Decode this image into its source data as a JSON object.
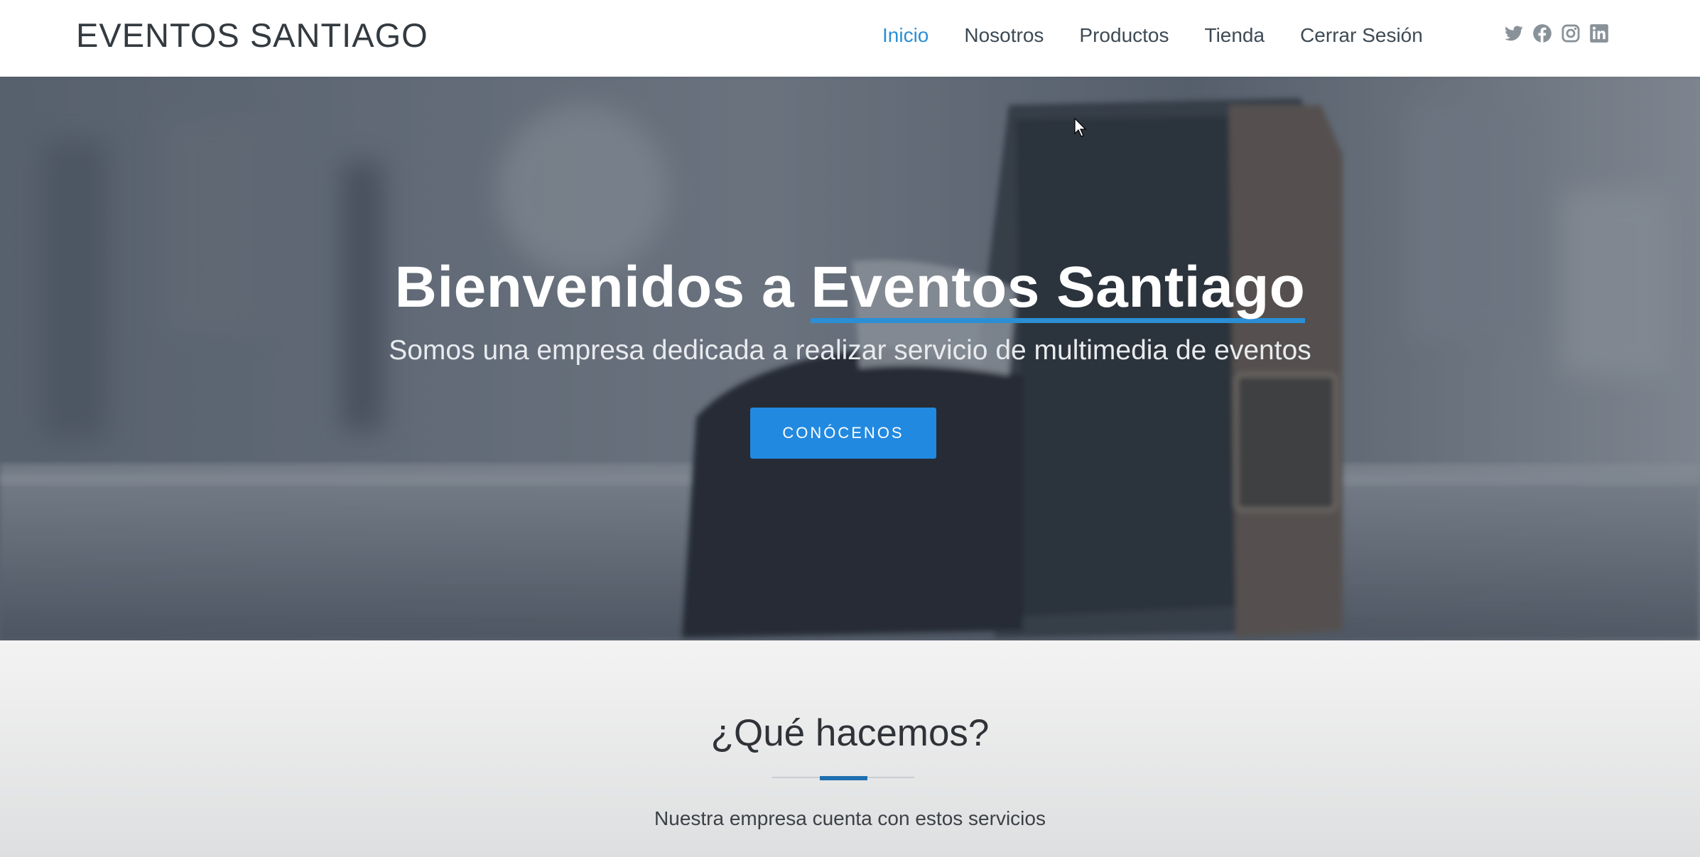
{
  "header": {
    "brand": "EVENTOS SANTIAGO",
    "nav": [
      {
        "label": "Inicio",
        "active": true
      },
      {
        "label": "Nosotros",
        "active": false
      },
      {
        "label": "Productos",
        "active": false
      },
      {
        "label": "Tienda",
        "active": false
      },
      {
        "label": "Cerrar Sesión",
        "active": false
      }
    ],
    "social_icons": [
      "twitter-icon",
      "facebook-icon",
      "instagram-icon",
      "linkedin-icon"
    ]
  },
  "hero": {
    "title_part1": "Bienvenidos a ",
    "title_highlight": "Eventos Santiago",
    "subtitle": "Somos una empresa dedicada a realizar servicio de multimedia de eventos",
    "button_label": "CONÓCENOS"
  },
  "services": {
    "title": "¿Qué hacemos?",
    "subtitle": "Nuestra empresa cuenta con estos servicios"
  },
  "colors": {
    "accent": "#2b8fd6",
    "button": "#2289e0",
    "divider_accent": "#1f6fb0",
    "text_dark": "#333a40"
  }
}
